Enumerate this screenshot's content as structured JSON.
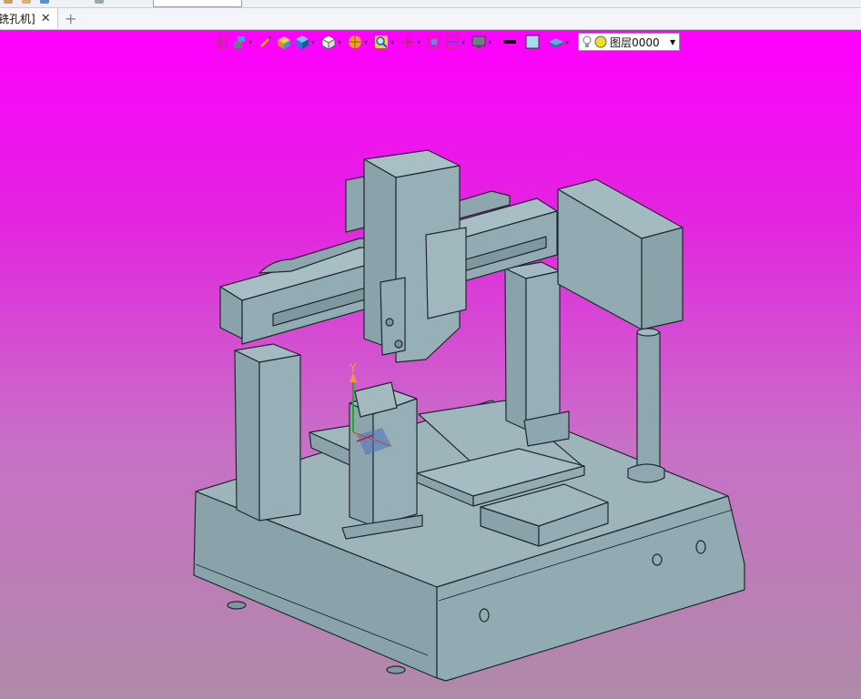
{
  "document_tab": {
    "label": "铣孔机]",
    "close_glyph": "✕"
  },
  "new_tab": {
    "glyph": "+"
  },
  "toolbar": {
    "buttons": [
      {
        "name": "exit-sketch-icon",
        "has_dropdown": false
      },
      {
        "name": "display-style-icon",
        "has_dropdown": true
      },
      {
        "name": "pick-filter-icon",
        "has_dropdown": false
      },
      {
        "name": "shaded-box-icon",
        "has_dropdown": false
      },
      {
        "name": "solid-cube-icon",
        "has_dropdown": true
      },
      {
        "name": "wire-cube-icon",
        "has_dropdown": true
      },
      {
        "name": "render-sphere-icon",
        "has_dropdown": true
      },
      {
        "name": "zoom-icon",
        "has_dropdown": true
      },
      {
        "name": "snap-icon",
        "has_dropdown": true
      },
      {
        "name": "fit-view-icon",
        "has_dropdown": false
      },
      {
        "name": "section-view-icon",
        "has_dropdown": true
      },
      {
        "name": "monitor-icon",
        "has_dropdown": true
      },
      {
        "name": "line-style-icon",
        "has_dropdown": false
      },
      {
        "name": "color-swatch-icon",
        "has_dropdown": false
      },
      {
        "name": "layer-plane-icon",
        "has_dropdown": true
      }
    ],
    "layer": {
      "label": "图层0000",
      "status_icons": [
        "lightbulb-icon",
        "layer-color-icon"
      ]
    }
  },
  "colors": {
    "viewport_top": "#ff00ff",
    "viewport_bottom": "#b08aa8",
    "model_fill": "#8fa9b0",
    "model_edge": "#1e2a2e"
  },
  "axis_triad": {
    "y_label": "Y"
  }
}
